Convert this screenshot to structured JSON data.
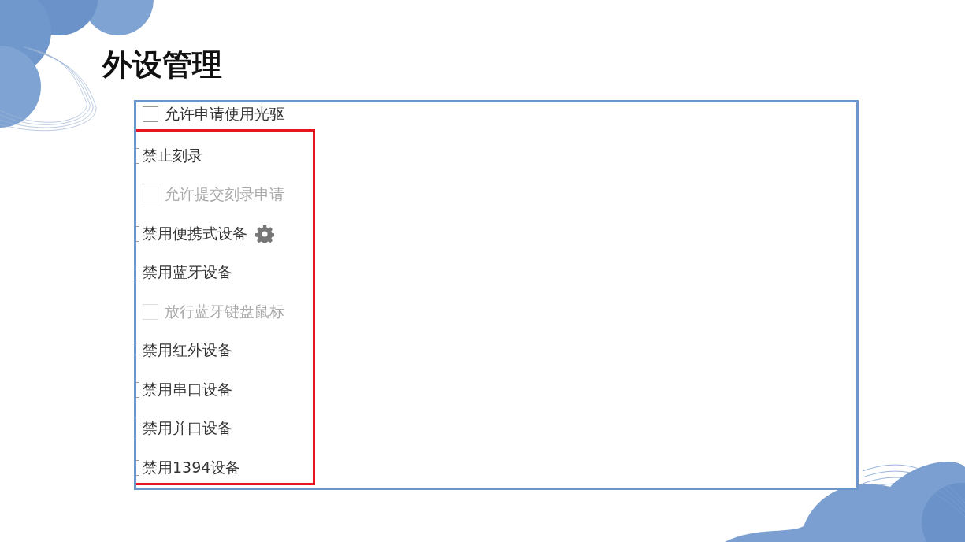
{
  "title": "外设管理",
  "top_item": {
    "label": "允许申请使用光驱",
    "checked": false,
    "disabled": false
  },
  "highlighted_items": [
    {
      "label": "禁止刻录",
      "checked": false,
      "disabled": false,
      "children": [
        {
          "label": "允许提交刻录申请",
          "checked": false,
          "disabled": true
        }
      ]
    },
    {
      "label": "禁用便携式设备",
      "checked": false,
      "disabled": false,
      "has_settings": true
    },
    {
      "label": "禁用蓝牙设备",
      "checked": false,
      "disabled": false,
      "children": [
        {
          "label": "放行蓝牙键盘鼠标",
          "checked": false,
          "disabled": true
        }
      ]
    },
    {
      "label": "禁用红外设备",
      "checked": false,
      "disabled": false
    },
    {
      "label": "禁用串口设备",
      "checked": false,
      "disabled": false
    },
    {
      "label": "禁用并口设备",
      "checked": false,
      "disabled": false
    },
    {
      "label": "禁用1394设备",
      "checked": false,
      "disabled": false
    }
  ]
}
